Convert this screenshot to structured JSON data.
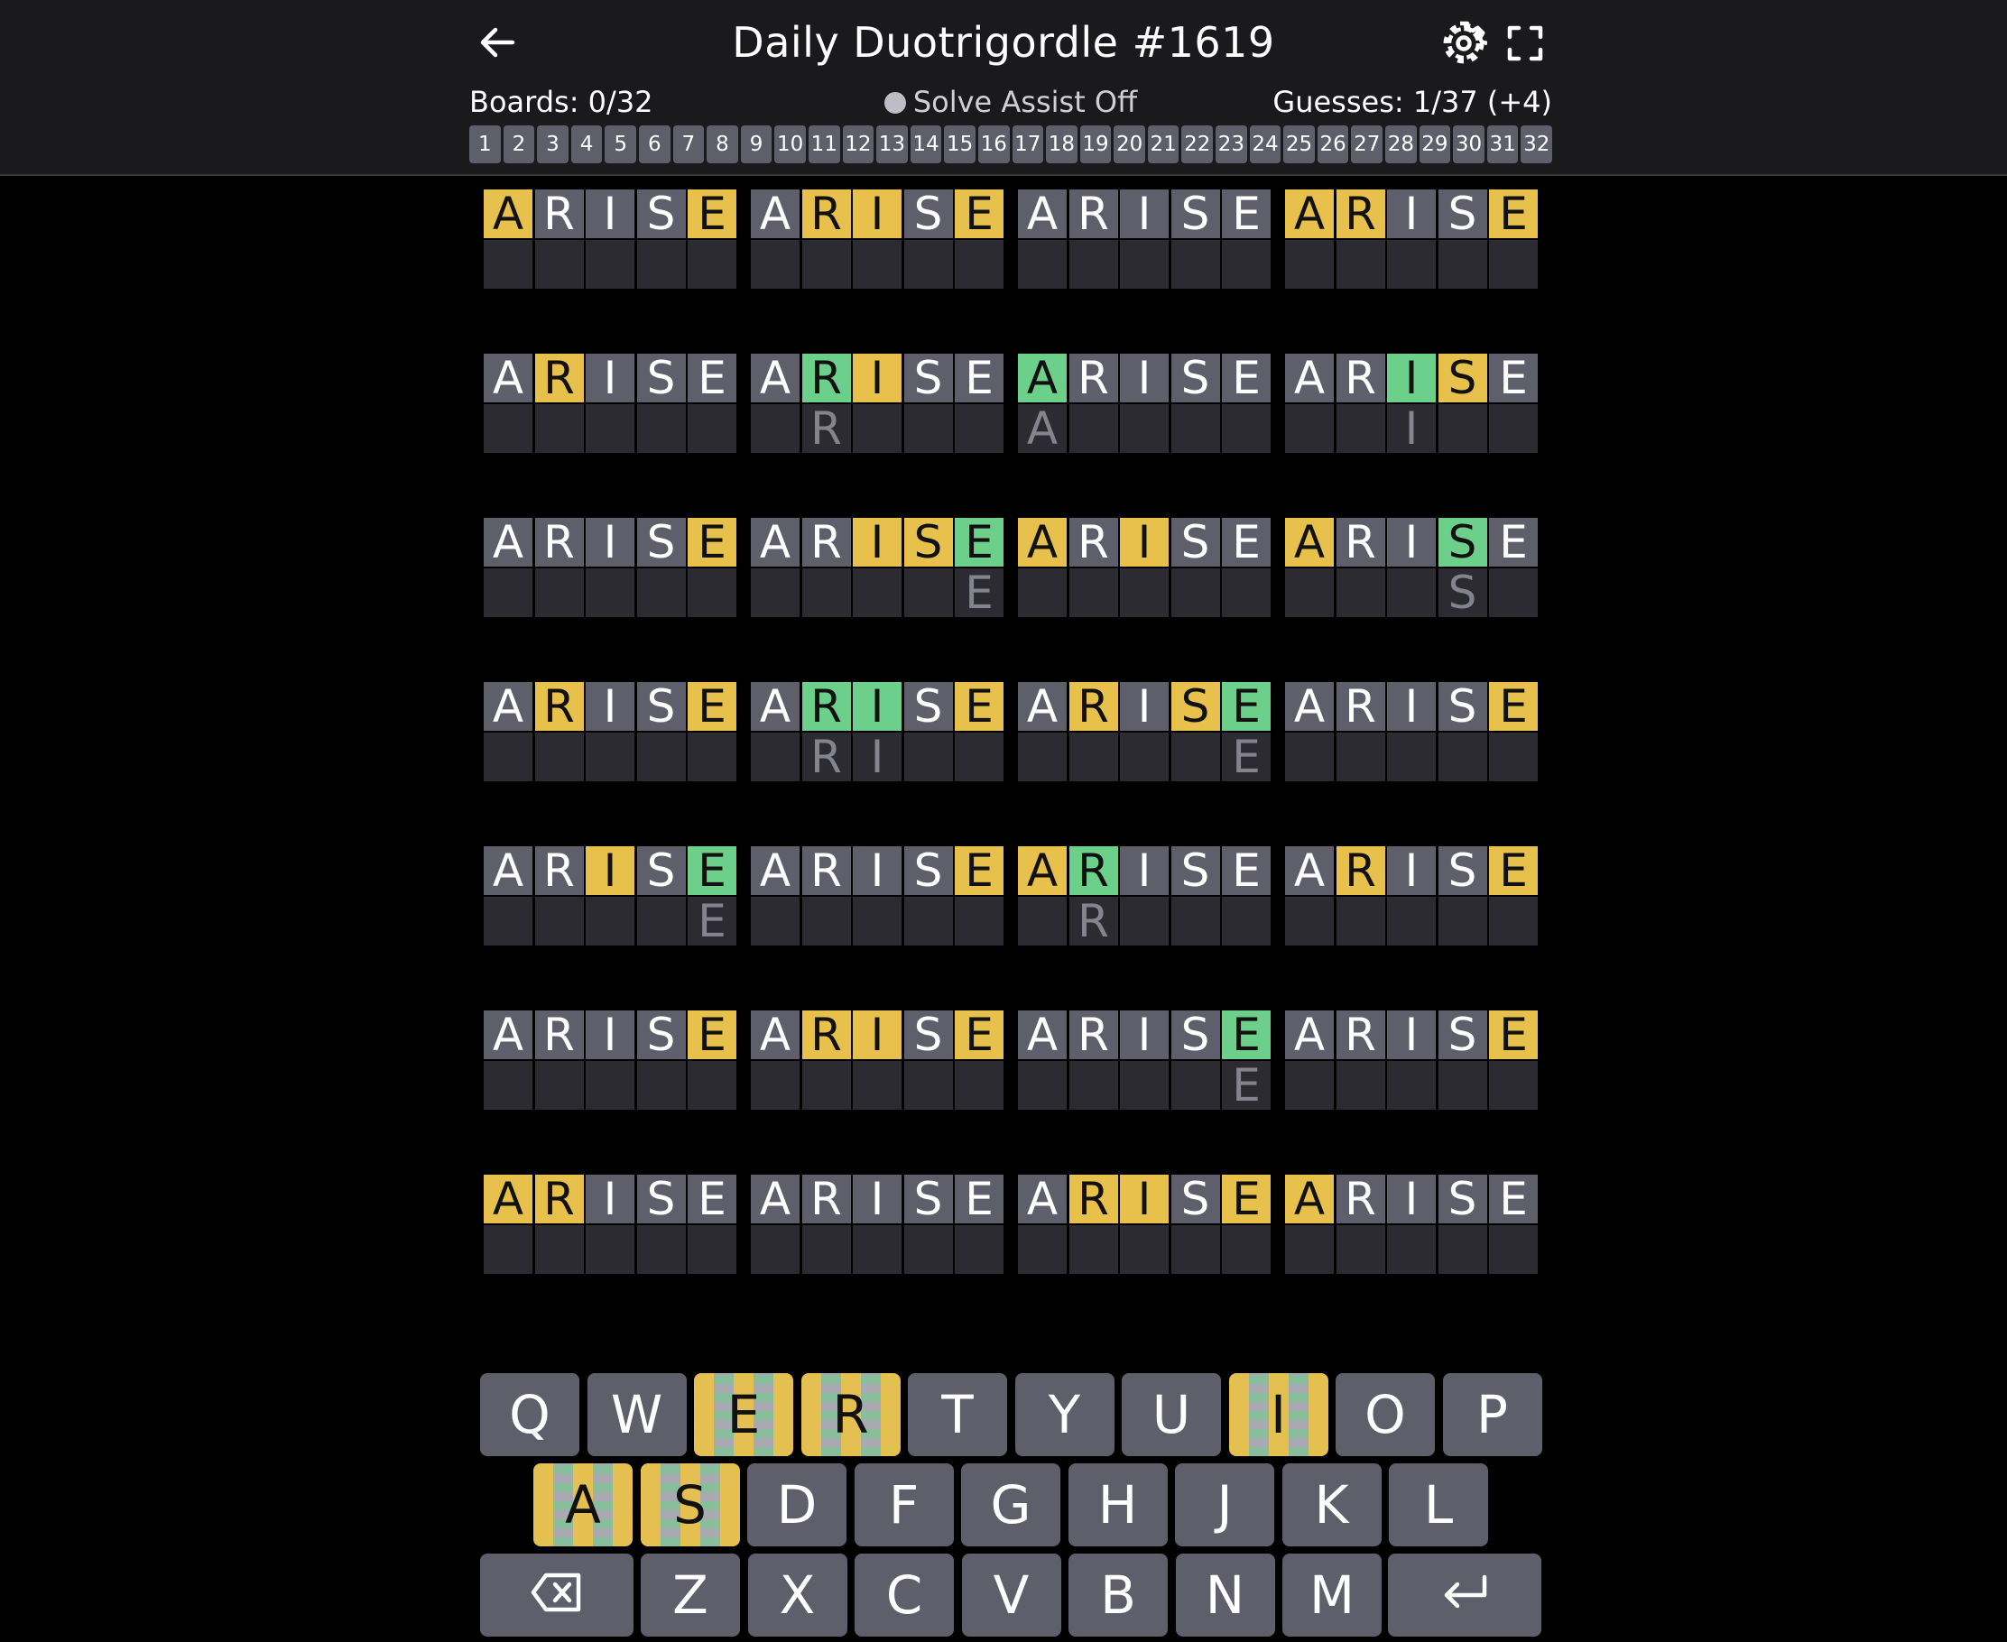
{
  "header": {
    "title": "Daily Duotrigordle #1619",
    "boards_status": "Boards: 0/32",
    "solve_assist": "Solve Assist Off",
    "guesses": "Guesses: 1/37 (+4)",
    "board_numbers": [
      "1",
      "2",
      "3",
      "4",
      "5",
      "6",
      "7",
      "8",
      "9",
      "10",
      "11",
      "12",
      "13",
      "14",
      "15",
      "16",
      "17",
      "18",
      "19",
      "20",
      "21",
      "22",
      "23",
      "24",
      "25",
      "26",
      "27",
      "28",
      "29",
      "30",
      "31",
      "32"
    ]
  },
  "icons": {
    "back": "arrow-left-icon",
    "settings": "gear-icon",
    "fullscreen": "fullscreen-icon",
    "backspace": "backspace-icon",
    "enter": "enter-icon"
  },
  "colors": {
    "present": "#e8c04c",
    "correct": "#6ccf8a",
    "absent": "#5f5f6b",
    "empty": "#2b2b31",
    "header_bg": "#1a1a1d"
  },
  "guess_word": "ARISE",
  "boards": [
    {
      "feedback": "yxxxy",
      "hints": "     "
    },
    {
      "feedback": "xyyxy",
      "hints": "     "
    },
    {
      "feedback": "xxxxx",
      "hints": "     "
    },
    {
      "feedback": "yyxxy",
      "hints": "     "
    },
    {
      "feedback": "xyxxx",
      "hints": "     "
    },
    {
      "feedback": "xgyxx",
      "hints": " R   "
    },
    {
      "feedback": "gxxxx",
      "hints": "A    "
    },
    {
      "feedback": "xxgyx",
      "hints": "  I  "
    },
    {
      "feedback": "xxxxy",
      "hints": "     "
    },
    {
      "feedback": "xxyyg",
      "hints": "    E"
    },
    {
      "feedback": "yxyxx",
      "hints": "     "
    },
    {
      "feedback": "yxxgx",
      "hints": "   S "
    },
    {
      "feedback": "xyxxy",
      "hints": "     "
    },
    {
      "feedback": "xggxy",
      "hints": " RI  "
    },
    {
      "feedback": "xyxyg",
      "hints": "    E"
    },
    {
      "feedback": "xxxxy",
      "hints": "     "
    },
    {
      "feedback": "xxyxg",
      "hints": "    E"
    },
    {
      "feedback": "xxxxy",
      "hints": "     "
    },
    {
      "feedback": "ygxxx",
      "hints": " R   "
    },
    {
      "feedback": "xyxxy",
      "hints": "     "
    },
    {
      "feedback": "xxxxy",
      "hints": "     "
    },
    {
      "feedback": "xyyxy",
      "hints": "     "
    },
    {
      "feedback": "xxxxg",
      "hints": "    E"
    },
    {
      "feedback": "xxxxy",
      "hints": "     "
    },
    {
      "feedback": "yyxxx",
      "hints": "     "
    },
    {
      "feedback": "xxxxx",
      "hints": "     "
    },
    {
      "feedback": "xyyxy",
      "hints": "     "
    },
    {
      "feedback": "yxxxx",
      "hints": "     "
    }
  ],
  "keyboard": {
    "row1": [
      "Q",
      "W",
      "E",
      "R",
      "T",
      "Y",
      "U",
      "I",
      "O",
      "P"
    ],
    "row2": [
      "A",
      "S",
      "D",
      "F",
      "G",
      "H",
      "J",
      "K",
      "L"
    ],
    "row3": [
      "Z",
      "X",
      "C",
      "V",
      "B",
      "N",
      "M"
    ],
    "mixed_keys": [
      "E",
      "R",
      "I",
      "A",
      "S"
    ]
  }
}
